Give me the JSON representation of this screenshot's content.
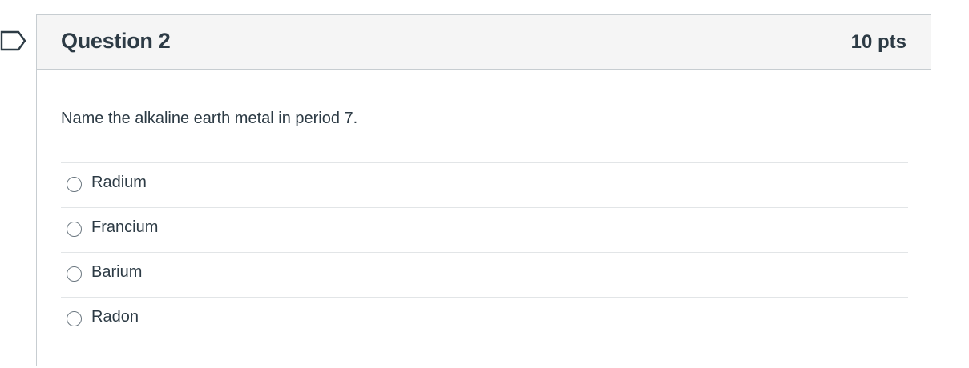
{
  "question": {
    "title": "Question 2",
    "points": "10 pts",
    "text": "Name the alkaline earth metal in period 7."
  },
  "answers": [
    {
      "label": "Radium",
      "selected": false
    },
    {
      "label": "Francium",
      "selected": false
    },
    {
      "label": "Barium",
      "selected": false
    },
    {
      "label": "Radon",
      "selected": false
    }
  ],
  "icons": {
    "flag": "flag-marker-icon",
    "radio": "radio-button-icon"
  },
  "colors": {
    "text": "#2d3b45",
    "header_bg": "#f5f5f5",
    "border": "#c7cdd1",
    "flag_stroke": "#2d3b45"
  }
}
